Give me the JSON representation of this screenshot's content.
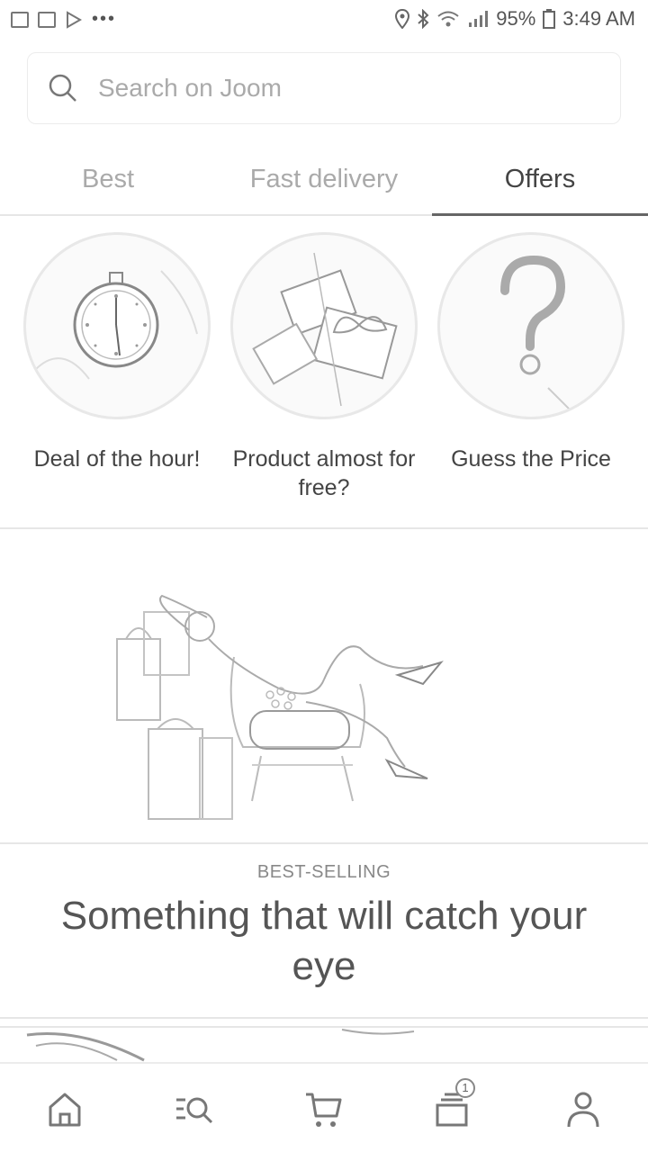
{
  "status_bar": {
    "battery": "95%",
    "time": "3:49 AM",
    "more": "•••",
    "icons": [
      "image-icon",
      "mail-icon",
      "play-icon",
      "location-icon",
      "bluetooth-icon",
      "wifi-icon",
      "signal-icon",
      "battery-icon"
    ]
  },
  "search": {
    "placeholder": "Search on Joom"
  },
  "tabs": [
    {
      "label": "Best"
    },
    {
      "label": "Fast delivery"
    },
    {
      "label": "Offers",
      "active": true
    }
  ],
  "offers": [
    {
      "label": "Deal of the hour!",
      "icon": "stopwatch-icon"
    },
    {
      "label": "Product almost for free?",
      "icon": "gift-icon"
    },
    {
      "label": "Guess the Price",
      "icon": "question-mark-icon"
    }
  ],
  "best_selling": {
    "kicker": "BEST-SELLING",
    "title": "Something that will catch your eye"
  },
  "bottom_nav": {
    "items": [
      "home-icon",
      "search-catalog-icon",
      "cart-icon",
      "orders-icon",
      "profile-icon"
    ],
    "orders_badge": "1"
  }
}
